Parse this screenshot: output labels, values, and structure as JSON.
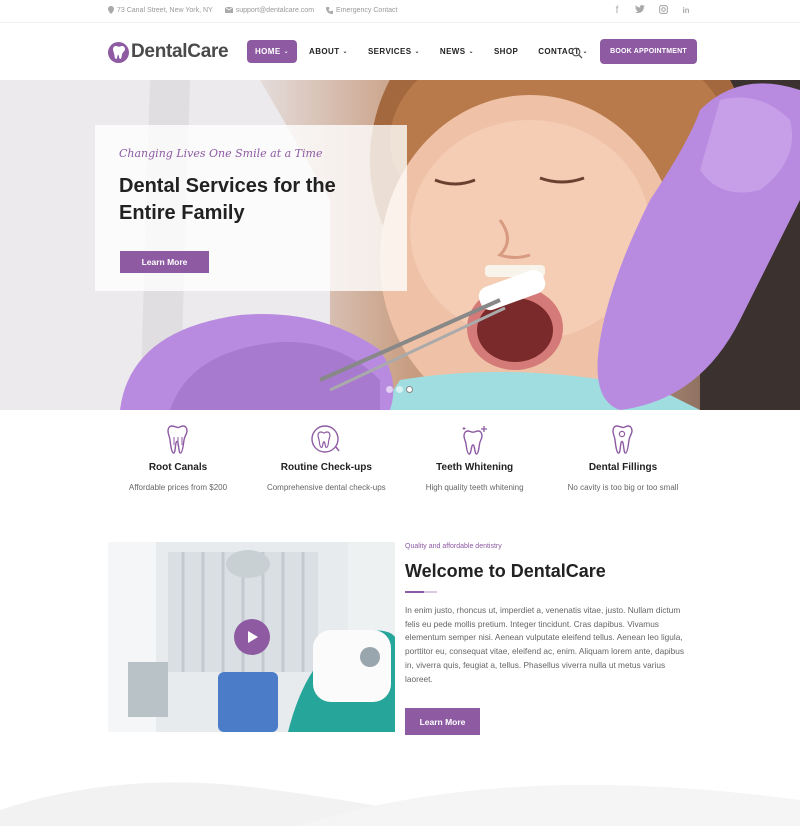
{
  "topbar": {
    "address": "73 Canal Street, New York, NY",
    "email": "support@dentalcare.com",
    "phone": "Emergency Contact",
    "social": [
      {
        "icon": "facebook-icon",
        "glyph": "f"
      },
      {
        "icon": "twitter-icon",
        "glyph": "🐦"
      },
      {
        "icon": "instagram-icon",
        "glyph": "◎"
      },
      {
        "icon": "linkedin-icon",
        "glyph": "in"
      }
    ]
  },
  "header": {
    "logo_text": "DentalCare",
    "nav": [
      {
        "label": "HOME",
        "dropdown": true,
        "active": true
      },
      {
        "label": "ABOUT",
        "dropdown": true
      },
      {
        "label": "SERVICES",
        "dropdown": true
      },
      {
        "label": "NEWS",
        "dropdown": true
      },
      {
        "label": "SHOP",
        "dropdown": false
      },
      {
        "label": "CONTACT",
        "dropdown": true
      }
    ],
    "book_label": "BOOK APPOINTMENT"
  },
  "hero": {
    "tagline": "Changing Lives One Smile at a Time",
    "title": "Dental Services for the Entire Family",
    "button": "Learn More",
    "slides": 3,
    "active_slide": 3
  },
  "features": [
    {
      "title": "Root Canals",
      "desc": "Affordable prices from $200",
      "icon": "tooth-root-icon"
    },
    {
      "title": "Routine Check-ups",
      "desc": "Comprehensive dental check-ups",
      "icon": "tooth-checkup-icon"
    },
    {
      "title": "Teeth Whitening",
      "desc": "High quality teeth whitening",
      "icon": "tooth-sparkle-icon"
    },
    {
      "title": "Dental Fillings",
      "desc": "No cavity is too big or too small",
      "icon": "tooth-filling-icon"
    }
  ],
  "welcome": {
    "eyebrow": "Quality and affordable dentistry",
    "title": "Welcome to DentalCare",
    "body": "In enim justo, rhoncus ut, imperdiet a, venenatis vitae, justo. Nullam dictum felis eu pede mollis pretium. Integer tincidunt. Cras dapibus. Vivamus elementum semper nisi. Aenean vulputate eleifend tellus. Aenean leo ligula, porttitor eu, consequat vitae, eleifend ac, enim. Aliquam lorem ante, dapibus in, viverra quis, feugiat a, tellus. Phasellus viverra nulla ut metus varius laoreet.",
    "button": "Learn More"
  },
  "colors": {
    "accent": "#8e5ba3",
    "text_dark": "#222222",
    "text_muted": "#666666"
  }
}
